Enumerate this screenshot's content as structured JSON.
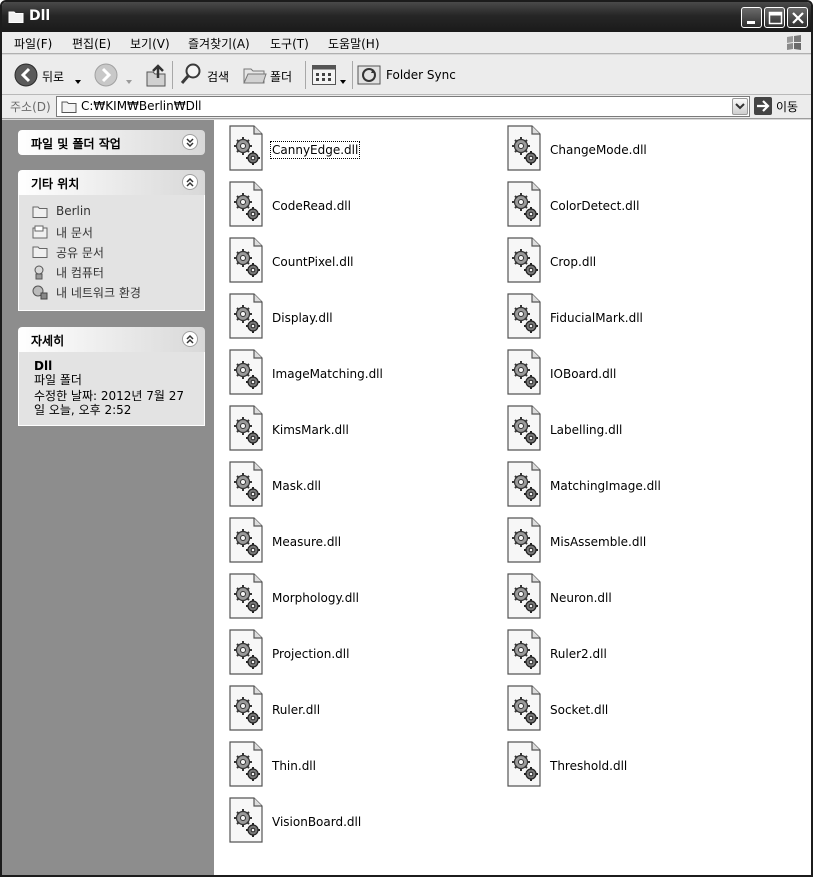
{
  "window": {
    "title": "Dll"
  },
  "menu": [
    "파일(F)",
    "편집(E)",
    "보기(V)",
    "즐겨찾기(A)",
    "도구(T)",
    "도움말(H)"
  ],
  "toolbar": {
    "back_label": "뒤로",
    "search_label": "검색",
    "folders_label": "폴더",
    "folder_sync_label": "Folder Sync"
  },
  "address": {
    "label": "주소(D)",
    "value": "C:₩KIM₩Berlin₩Dll",
    "go_label": "이동"
  },
  "tasks": {
    "file_folder_tasks": {
      "title": "파일 및 폴더 작업"
    },
    "other_places": {
      "title": "기타 위치",
      "items": [
        {
          "label": "Berlin",
          "icon": "folder-icon"
        },
        {
          "label": "내 문서",
          "icon": "my-documents-icon"
        },
        {
          "label": "공유 문서",
          "icon": "folder-icon"
        },
        {
          "label": "내 컴퓨터",
          "icon": "my-computer-icon"
        },
        {
          "label": "내 네트워크 환경",
          "icon": "network-places-icon"
        }
      ]
    },
    "details": {
      "title": "자세히",
      "name": "Dll",
      "type": "파일 폴더",
      "modified": "수정한 날짜: 2012년 7월 27 일 오늘, 오후 2:52"
    }
  },
  "files": [
    "CannyEdge.dll",
    "ChangeMode.dll",
    "CodeRead.dll",
    "ColorDetect.dll",
    "CountPixel.dll",
    "Crop.dll",
    "Display.dll",
    "FiducialMark.dll",
    "ImageMatching.dll",
    "IOBoard.dll",
    "KimsMark.dll",
    "Labelling.dll",
    "Mask.dll",
    "MatchingImage.dll",
    "Measure.dll",
    "MisAssemble.dll",
    "Morphology.dll",
    "Neuron.dll",
    "Projection.dll",
    "Ruler2.dll",
    "Ruler.dll",
    "Socket.dll",
    "Thin.dll",
    "Threshold.dll",
    "VisionBoard.dll"
  ],
  "colors": {
    "titlebar": "#262626",
    "task_pane": "#8d8d8d",
    "panel_body": "#e3e3e3"
  }
}
